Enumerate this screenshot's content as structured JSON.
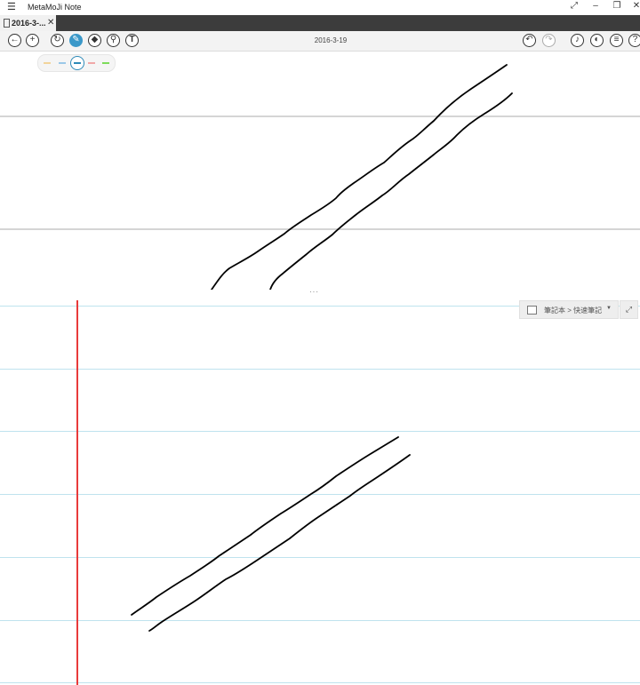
{
  "app": {
    "menu_icon": "hamburger-icon",
    "title": "MetaMoJi Note",
    "window_buttons": [
      "⤢",
      "–",
      "❐",
      "✕"
    ]
  },
  "tab": {
    "label": "2016-3-...",
    "close": "✕"
  },
  "toolbar": {
    "date": "2016-3-19",
    "left_icons": [
      "back-icon",
      "add-icon",
      "lasso-icon",
      "pen-icon",
      "eraser-icon",
      "highlighter-icon",
      "text-icon"
    ],
    "right_icons": [
      "undo-icon",
      "redo-icon",
      "mic-icon",
      "sync-icon",
      "list-icon",
      "help-icon"
    ],
    "glyphs": {
      "back": "←",
      "add": "+",
      "lasso": "↻",
      "pen": "✎",
      "eraser": "◆",
      "highlighter": "⚲",
      "text": "T",
      "undo": "↶",
      "redo": "↷",
      "mic": "♪",
      "sync": "◐",
      "list": "≡",
      "help": "?"
    }
  },
  "pen_palette": {
    "colors": [
      "#f2d49b",
      "#9bc8e8",
      "#2e8ab8",
      "#f0a8a8",
      "#7ddc5a"
    ],
    "selected_index": 2
  },
  "divider": "···",
  "notebook": {
    "breadcrumb": "筆記本 > 快速筆記",
    "dropdown_arrow": "▼",
    "expand": "⤢"
  },
  "colors": {
    "tabbar": "#3c3c3c",
    "accent": "#3a98c9",
    "margin_line": "#e83a3a",
    "ruled_line": "#bfe3ee",
    "ink": "#000000"
  }
}
